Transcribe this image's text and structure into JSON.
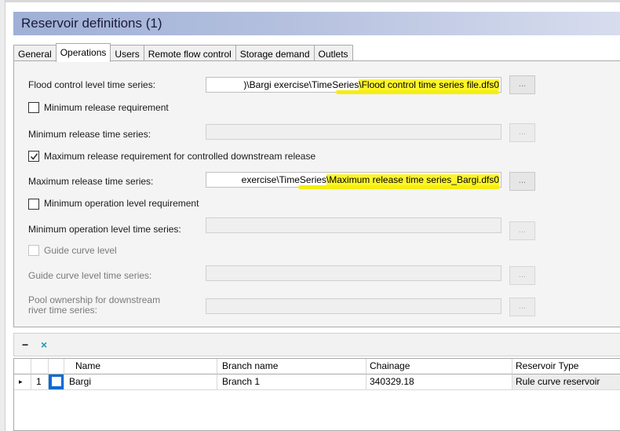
{
  "window": {
    "title": "Reservoir definitions (1)"
  },
  "tabs": [
    "General",
    "Operations",
    "Users",
    "Remote flow control",
    "Storage demand",
    "Outlets"
  ],
  "operations": {
    "flood_control": {
      "label": "Flood control level time series:",
      "value_prefix": ")\\Bargi exercise\\TimeSeries",
      "value_highlight": "\\Flood control time series file.dfs0",
      "browse": "..."
    },
    "min_release_req": {
      "label": "Minimum release requirement",
      "checked": false
    },
    "min_release_ts": {
      "label": "Minimum release time series:",
      "value": "",
      "browse": "..."
    },
    "max_release_req": {
      "label": "Maximum release requirement for controlled downstream release",
      "checked": true
    },
    "max_release_ts": {
      "label": "Maximum release time series:",
      "value_prefix": "exercise\\TimeSeries",
      "value_highlight": "\\Maximum release time series_Bargi.dfs0",
      "browse": "..."
    },
    "min_op_level_req": {
      "label": "Minimum operation level requirement",
      "checked": false
    },
    "min_op_level_ts": {
      "label": "Minimum operation level time series:",
      "value": "",
      "browse": "..."
    },
    "guide_curve": {
      "label": "Guide curve level",
      "checked": false
    },
    "guide_curve_ts": {
      "label": "Guide curve level time series:",
      "value": "",
      "browse": "..."
    },
    "pool_ownership": {
      "label_line1": "Pool ownership for downstream",
      "label_line2": "river time series:",
      "value": "",
      "browse": "..."
    }
  },
  "toolbar": {
    "remove_label": "−",
    "delete_label": "×"
  },
  "table": {
    "columns": [
      "Name",
      "Branch name",
      "Chainage",
      "Reservoir Type"
    ],
    "rows": [
      {
        "indicator": "▸",
        "index": "1",
        "name": "Bargi",
        "branch": "Branch 1",
        "chainage": "340329.18",
        "type": "Rule curve reservoir"
      }
    ]
  },
  "colors": {
    "title_gradient_start": "#9fb0d6",
    "highlight": "#fdf52a",
    "selection": "#0a6bd6"
  }
}
